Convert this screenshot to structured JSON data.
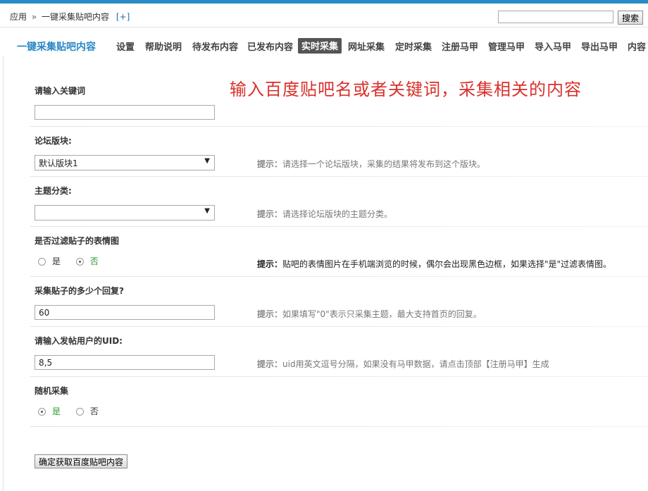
{
  "breadcrumb": {
    "app": "应用",
    "separator": "»",
    "page": "一键采集贴吧内容",
    "plus": "[+]"
  },
  "search": {
    "value": "",
    "button_label": "搜索"
  },
  "nav": {
    "brand": "一键采集贴吧内容",
    "items": [
      "设置",
      "帮助说明",
      "待发布内容",
      "已发布内容",
      "实时采集",
      "网址采集",
      "定时采集",
      "注册马甲",
      "管理马甲",
      "导入马甲",
      "导出马甲",
      "内容"
    ],
    "active_index": 4
  },
  "headline": "输入百度贴吧名或者关键词，采集相关的内容",
  "form": {
    "keyword": {
      "label": "请输入关键词",
      "value": ""
    },
    "forum": {
      "label": "论坛版块:",
      "selected": "默认版块1",
      "tip_prefix": "提示：",
      "tip": "请选择一个论坛版块，采集的结果将发布到这个版块。"
    },
    "topic_type": {
      "label": "主题分类:",
      "selected": "",
      "tip_prefix": "提示：",
      "tip": "请选择论坛版块的主题分类。"
    },
    "filter_emoji": {
      "label": "是否过滤贴子的表情图",
      "options": [
        "是",
        "否"
      ],
      "selected": "否",
      "tip_prefix": "提示：",
      "tip": "贴吧的表情图片在手机端浏览的时候，偶尔会出现黑色边框，如果选择\"是\"过滤表情图。"
    },
    "reply_count": {
      "label": "采集贴子的多少个回复?",
      "value": "60",
      "tip_prefix": "提示：",
      "tip": "如果填写\"0\"表示只采集主题，最大支持首页的回复。"
    },
    "uid": {
      "label": "请输入发帖用户的UID:",
      "value": "8,5",
      "tip_prefix": "提示：",
      "tip": "uid用英文逗号分隔，如果没有马甲数据，请点击顶部【注册马甲】生成"
    },
    "random": {
      "label": "随机采集",
      "options": [
        "是",
        "否"
      ],
      "selected": "是"
    }
  },
  "submit_label": "确定获取百度贴吧内容",
  "colors": {
    "accent": "#2a87c5",
    "headline": "#d9302b",
    "selected_option": "#2a9a2a",
    "active_nav_bg": "#555555"
  }
}
